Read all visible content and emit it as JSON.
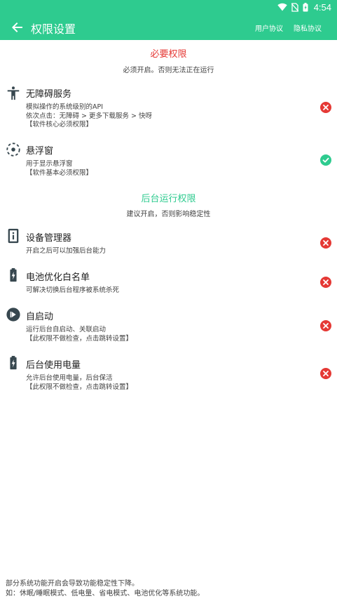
{
  "status_bar": {
    "time": "4:54",
    "icons": [
      "wifi-icon",
      "no-sim-icon",
      "battery-charging-icon"
    ]
  },
  "app_bar": {
    "back_icon": "arrow-left-icon",
    "title": "权限设置",
    "user_agreement": "用户协议",
    "privacy_agreement": "隐私协议"
  },
  "colors": {
    "accent": "#2ecb8f",
    "error": "#e53935",
    "success": "#2ecb8f"
  },
  "required_section": {
    "title": "必要权限",
    "subtitle": "必须开启。否则无法正在运行",
    "items": [
      {
        "icon": "accessibility-icon",
        "title": "无障碍服务",
        "description": "模拟操作的系统级别的API\n依次点击：无障碍 > 更多下载服务 > 快呀\n【软件核心必须权限】",
        "status": "denied"
      },
      {
        "icon": "floating-window-icon",
        "title": "悬浮窗",
        "description": "用于显示悬浮窗\n【软件基本必须权限】",
        "status": "granted"
      }
    ]
  },
  "background_section": {
    "title": "后台运行权限",
    "subtitle": "建议开启，否则影响稳定性",
    "items": [
      {
        "icon": "device-admin-icon",
        "title": "设备管理器",
        "description": "开启之后可以加强后台能力",
        "status": "denied"
      },
      {
        "icon": "battery-charging-icon",
        "title": "电池优化白名单",
        "description": "可解决切换后台程序被系统杀死",
        "status": "denied"
      },
      {
        "icon": "autostart-icon",
        "title": "自启动",
        "description": "运行后台自启动、关联启动\n【此权限不做检查，点击跳转设置】",
        "status": "denied"
      },
      {
        "icon": "battery-charging-icon",
        "title": "后台使用电量",
        "description": "允许后台使用电量，后台保活\n【此权限不做检查，点击跳转设置】",
        "status": "denied"
      }
    ]
  },
  "footer": {
    "note": "部分系统功能开启会导致功能稳定性下降。\n如：休眠/睡眠模式、低电量、省电模式、电池优化等系统功能。"
  }
}
